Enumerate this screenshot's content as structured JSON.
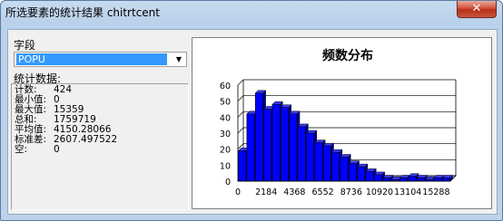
{
  "window": {
    "title": "所选要素的统计结果 chitrtcent",
    "close_glyph": "✕"
  },
  "field": {
    "label": "字段",
    "selected": "POPU"
  },
  "stats": {
    "title": "统计数据:",
    "rows": [
      {
        "key": "计数:",
        "value": "424"
      },
      {
        "key": "最小值:",
        "value": "0"
      },
      {
        "key": "最大值:",
        "value": "15359"
      },
      {
        "key": "总和:",
        "value": "1759719"
      },
      {
        "key": "平均值:",
        "value": "4150.28066"
      },
      {
        "key": "标准差:",
        "value": "2607.497522"
      },
      {
        "key": "空:",
        "value": "0"
      }
    ]
  },
  "chart_data": {
    "type": "bar",
    "title": "频数分布",
    "ylim": [
      0,
      60
    ],
    "y_ticks": [
      "0",
      "10",
      "20",
      "30",
      "40",
      "50",
      "60"
    ],
    "x_ticks": [
      "0",
      "2184",
      "4368",
      "6552",
      "8736",
      "10920",
      "13104",
      "15288"
    ],
    "values": [
      19,
      42,
      55,
      45,
      48,
      46,
      42,
      34,
      30,
      24,
      22,
      18,
      15,
      11,
      9,
      6,
      4,
      2,
      1,
      2,
      3,
      2,
      1,
      2,
      2
    ],
    "bar_color": "#0000ff",
    "grid": true
  }
}
